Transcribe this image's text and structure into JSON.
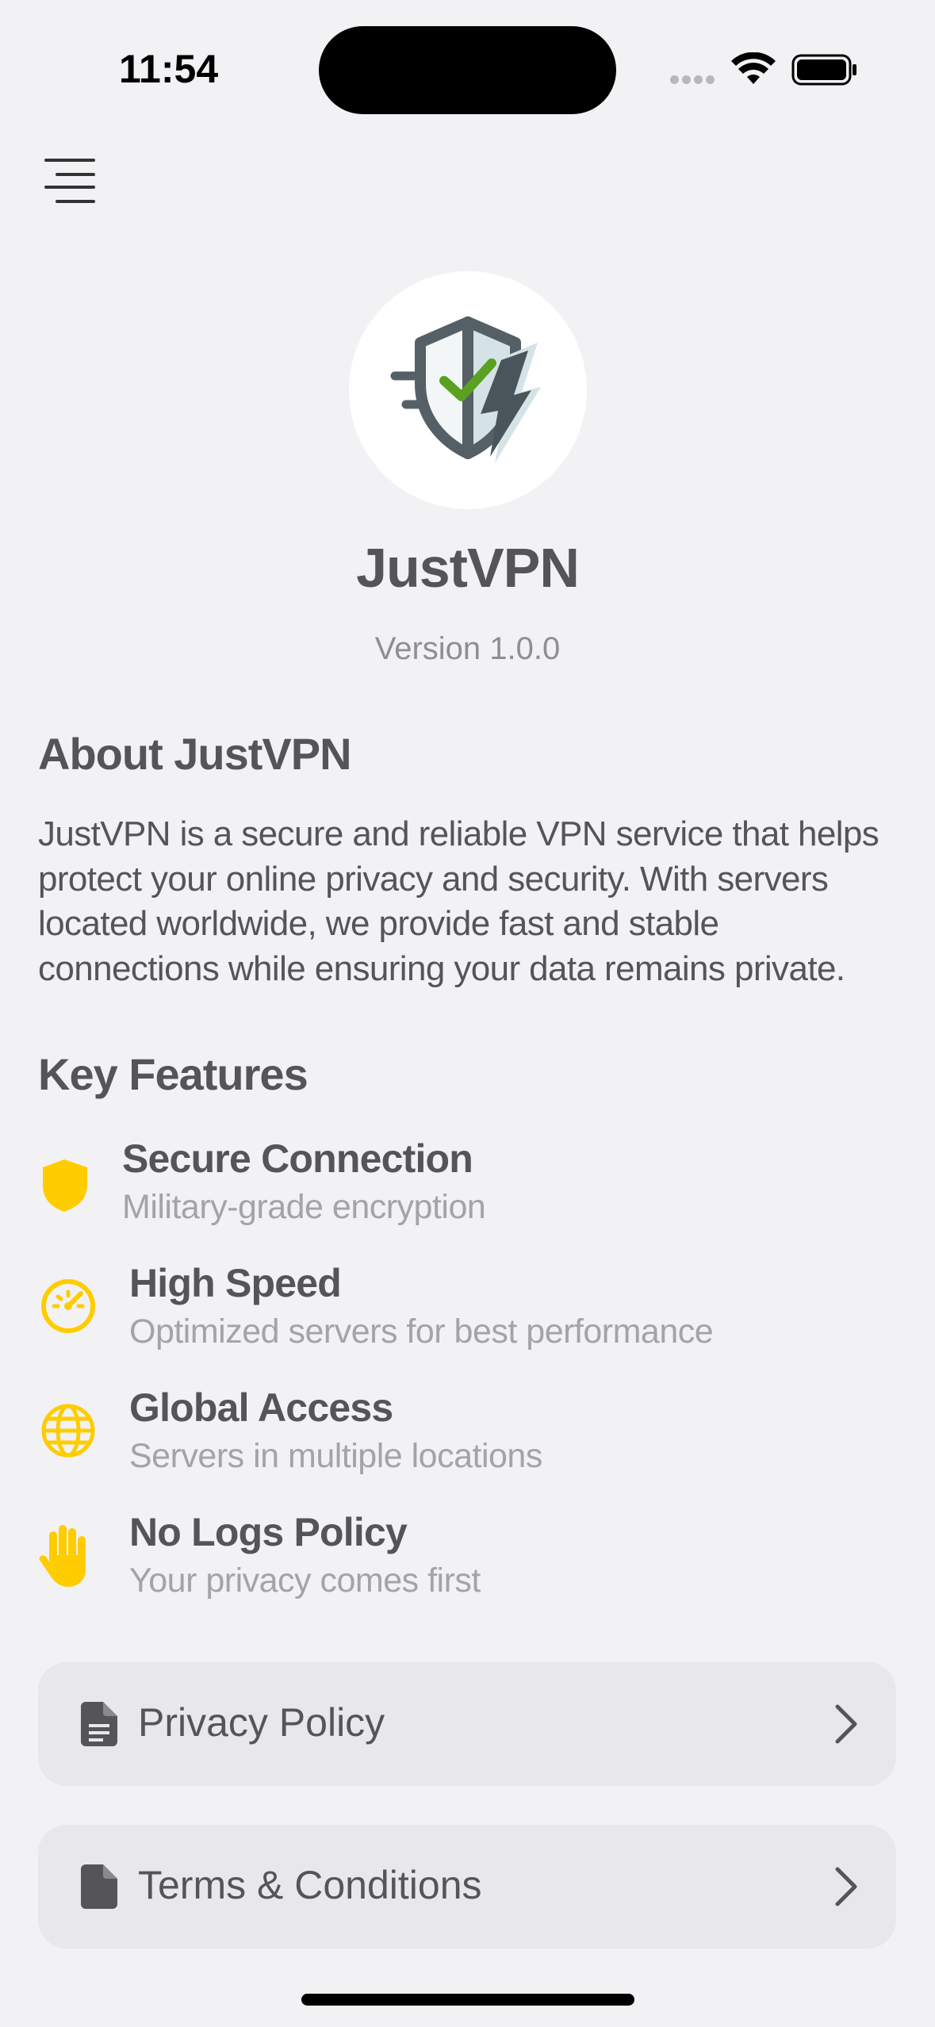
{
  "status_bar": {
    "time": "11:54"
  },
  "header": {
    "menu_icon": "menu-lines-icon"
  },
  "app": {
    "logo_icon": "shield-check-bolt-icon",
    "name": "JustVPN",
    "version": "Version 1.0.0"
  },
  "about": {
    "title": "About JustVPN",
    "body": "JustVPN is a secure and reliable VPN service that helps protect your online privacy and security. With servers located worldwide, we provide fast and stable connections while ensuring your data remains private."
  },
  "features": {
    "title": "Key Features",
    "items": [
      {
        "icon": "shield-icon",
        "title": "Secure Connection",
        "subtitle": "Military-grade encryption"
      },
      {
        "icon": "speedometer-icon",
        "title": "High Speed",
        "subtitle": "Optimized servers for best performance"
      },
      {
        "icon": "globe-icon",
        "title": "Global Access",
        "subtitle": "Servers in multiple locations"
      },
      {
        "icon": "hand-icon",
        "title": "No Logs Policy",
        "subtitle": "Your privacy comes first"
      }
    ]
  },
  "links": [
    {
      "icon": "document-text-icon",
      "label": "Privacy Policy"
    },
    {
      "icon": "document-icon",
      "label": "Terms & Conditions"
    }
  ],
  "colors": {
    "background": "#f2f2f4",
    "accent_yellow": "#ffcc00",
    "text_primary": "#555557",
    "text_secondary": "#a3a3a8",
    "check_green": "#5aa021"
  }
}
